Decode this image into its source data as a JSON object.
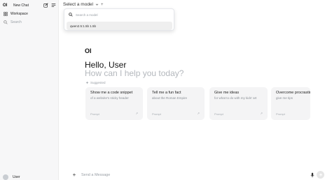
{
  "sidebar": {
    "logo": "OI",
    "new_chat_label": "New Chat",
    "workspace_label": "Workspace",
    "search_placeholder": "Search",
    "user_name": "User"
  },
  "header": {
    "model_select_label": "Select a model"
  },
  "model_dropdown": {
    "search_placeholder": "Search a model",
    "items": [
      {
        "label": "qwen2.5:1.5b 1.5b"
      }
    ]
  },
  "main": {
    "logo": "OI",
    "greeting": "Hello, User",
    "subtitle": "How can I help you today?",
    "suggested_label": "Suggested",
    "cards": [
      {
        "title": "Show me a code snippet",
        "subtitle": "of a website's sticky header",
        "footer": "Prompt"
      },
      {
        "title": "Tell me a fun fact",
        "subtitle": "about the Roman Empire",
        "footer": "Prompt"
      },
      {
        "title": "Give me ideas",
        "subtitle": "for what to do with my kids' art",
        "footer": "Prompt"
      },
      {
        "title": "Overcome procrastination",
        "subtitle": "give me tips",
        "footer": "Prompt"
      }
    ]
  },
  "message_bar": {
    "placeholder": "Send a Message"
  },
  "icons": {
    "new_chat": "pencil-square-icon",
    "menu": "menu-icon",
    "workspace": "grid-icon",
    "search": "search-icon",
    "chevron": "chevron-down-icon",
    "add_model": "plus-icon",
    "suggested": "sparkle-icon",
    "card_arrow": "arrow-up-right-icon",
    "message_add": "plus-icon",
    "mic": "microphone-icon",
    "send": "arrow-up-icon"
  }
}
